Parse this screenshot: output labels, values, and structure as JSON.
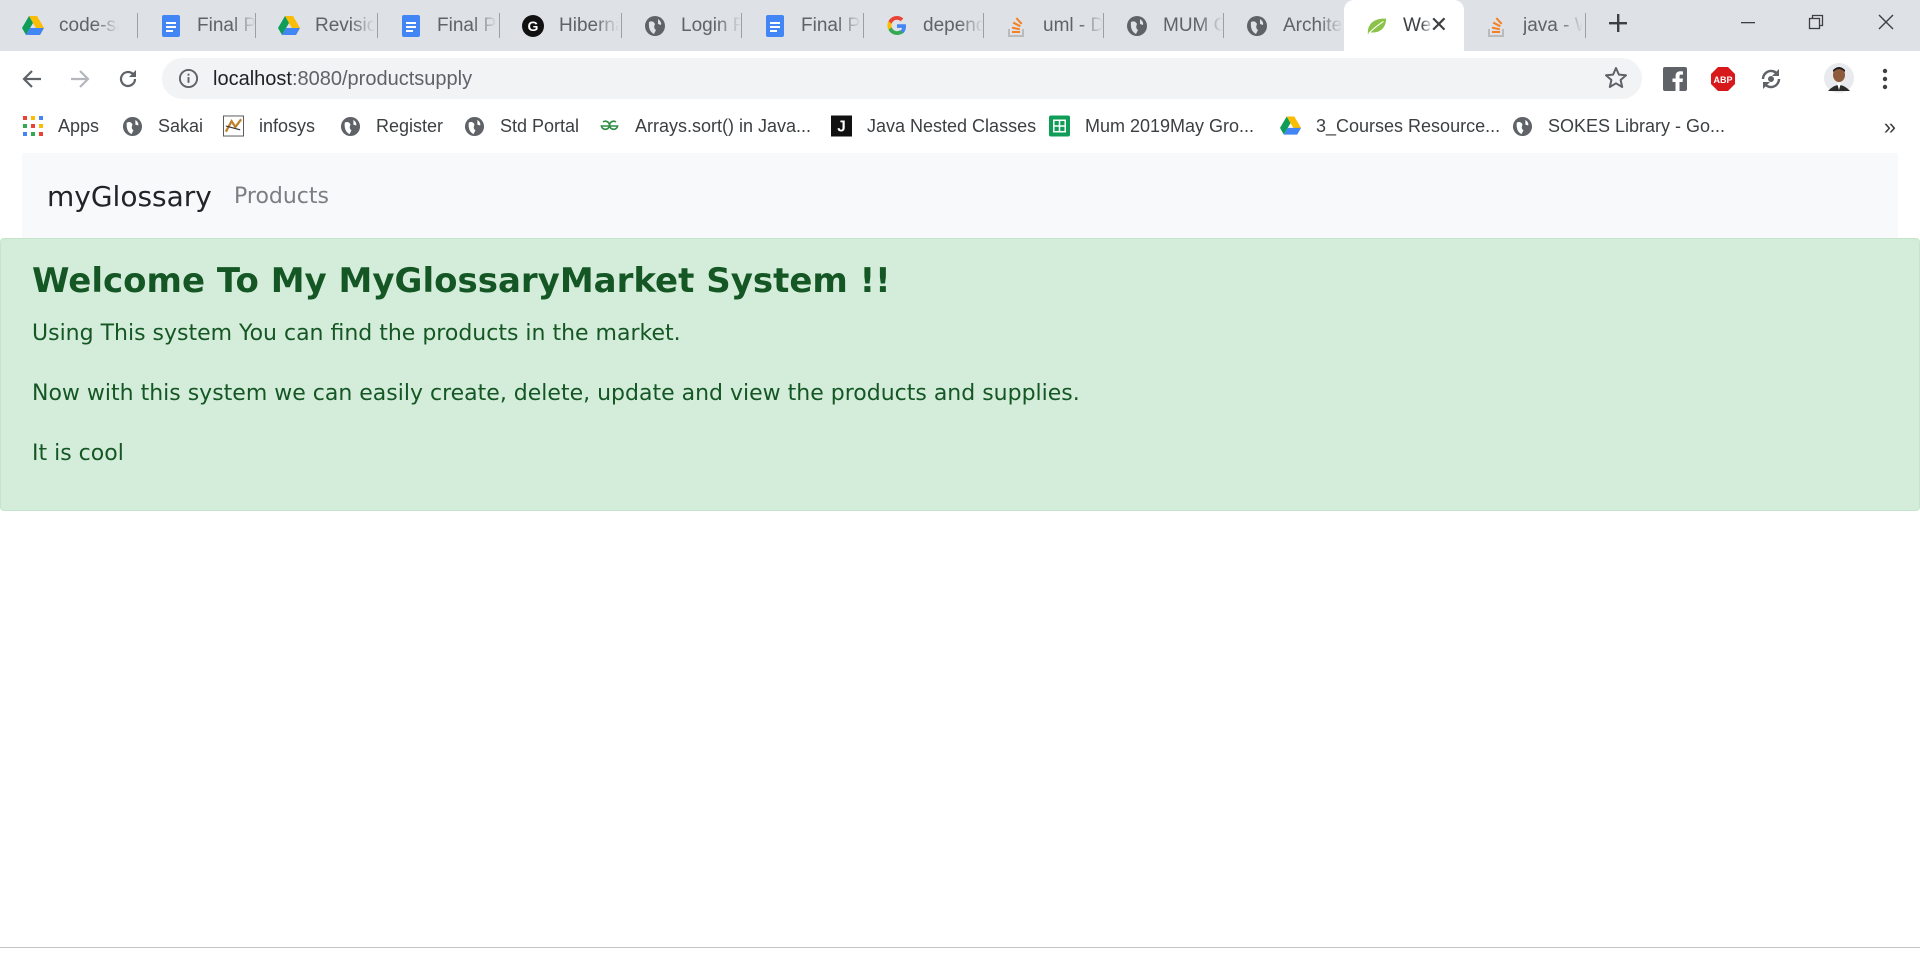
{
  "browser": {
    "tabs": [
      {
        "title": "code-sa",
        "icon": "google-drive-icon"
      },
      {
        "title": "Final Pr",
        "icon": "google-docs-icon"
      },
      {
        "title": "Revision",
        "icon": "google-drive-icon"
      },
      {
        "title": "Final Pr",
        "icon": "google-docs-icon"
      },
      {
        "title": "Hiberna",
        "icon": "github-icon"
      },
      {
        "title": "Login R",
        "icon": "globe-icon"
      },
      {
        "title": "Final Pr",
        "icon": "google-docs-icon"
      },
      {
        "title": "depend",
        "icon": "google-icon"
      },
      {
        "title": "uml - D",
        "icon": "stackoverflow-icon"
      },
      {
        "title": "MUM C",
        "icon": "globe-icon"
      },
      {
        "title": "Archite",
        "icon": "globe-icon"
      },
      {
        "title": "Wel",
        "icon": "spring-leaf-icon",
        "active": true
      },
      {
        "title": "java - W",
        "icon": "stackoverflow-icon"
      }
    ],
    "url_host": "localhost",
    "url_path": ":8080/productsupply",
    "bookmarks": [
      {
        "label": "Apps",
        "icon": "apps-grid-icon"
      },
      {
        "label": "Sakai",
        "icon": "globe-icon"
      },
      {
        "label": "infosys",
        "icon": "infosys-icon"
      },
      {
        "label": "Register",
        "icon": "globe-icon"
      },
      {
        "label": "Std Portal",
        "icon": "globe-icon"
      },
      {
        "label": "Arrays.sort() in Java...",
        "icon": "geeksforgeeks-icon"
      },
      {
        "label": "Java Nested Classes",
        "icon": "j-icon"
      },
      {
        "label": "Mum 2019May Gro...",
        "icon": "google-sheets-icon"
      },
      {
        "label": "3_Courses Resource...",
        "icon": "google-drive-icon"
      },
      {
        "label": "SOKES Library - Go...",
        "icon": "globe-icon"
      }
    ],
    "bookmarks_more": "»",
    "extensions": {
      "abp_label": "ABP"
    },
    "colors": {
      "tabstrip": "#dee1e6",
      "omnibox": "#f1f3f4"
    }
  },
  "page": {
    "navbar": {
      "brand": "myGlossary",
      "link": "Products"
    },
    "alert": {
      "heading": "Welcome To My MyGlossaryMarket System !!",
      "lines": [
        "Using This system You can find the products in the market.",
        "Now with this system we can easily create, delete, update and view the products and supplies.",
        "It is cool"
      ]
    },
    "colors": {
      "alert_bg": "#d4edda",
      "alert_text": "#155724",
      "navbar_bg": "#f8f9fa"
    }
  }
}
